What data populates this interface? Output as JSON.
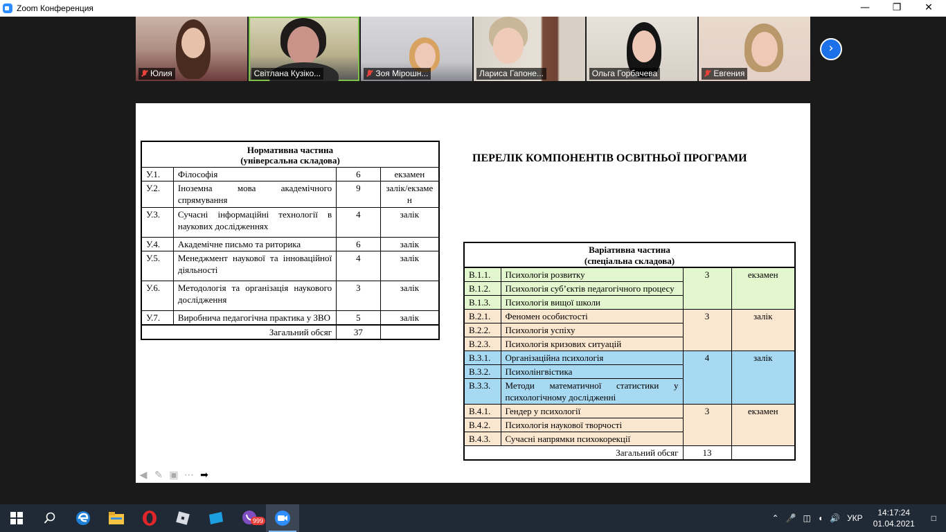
{
  "window": {
    "title": "Zoom Конференция",
    "minimize": "—",
    "maximize": "❐",
    "close": "✕"
  },
  "participants": [
    {
      "name": "Юлия",
      "muted": true
    },
    {
      "name": "Світлана Кузіко...",
      "muted": false,
      "active": true
    },
    {
      "name": "Зоя Мірошн...",
      "muted": true
    },
    {
      "name": "Лариса Гапоне...",
      "muted": false
    },
    {
      "name": "Ольга Горбачева",
      "muted": false
    },
    {
      "name": "Евгения",
      "muted": true
    }
  ],
  "slide": {
    "heading": "ПЕРЕЛІК КОМПОНЕНТІВ ОСВІТНЬОЇ ПРОГРАМИ",
    "normative": {
      "title1": "Нормативна частина",
      "title2": "(універсальна складова)",
      "rows": [
        {
          "code": "У.1.",
          "name": "Філософія",
          "credits": "6",
          "form": "екзамен"
        },
        {
          "code": "У.2.",
          "name": "Іноземна мова академічного спрямування",
          "credits": "9",
          "form": "залік/екзаме н"
        },
        {
          "code": "У.3.",
          "name": "Сучасні інформаційні технології в наукових дослідженнях",
          "credits": "4",
          "form": "залік"
        },
        {
          "code": "У.4.",
          "name": "Академічне письмо та риторика",
          "credits": "6",
          "form": "залік"
        },
        {
          "code": "У.5.",
          "name": "Менеджмент наукової та інноваційної діяльності",
          "credits": "4",
          "form": "залік"
        },
        {
          "code": "У.6.",
          "name": "Методологія та організація наукового дослідження",
          "credits": "3",
          "form": "залік"
        },
        {
          "code": "У.7.",
          "name": "Виробнича педагогічна практика у ЗВО",
          "credits": "5",
          "form": "залік"
        }
      ],
      "total_label": "Загальний обсяг",
      "total_value": "37"
    },
    "variative": {
      "title1": "Варіативна частина",
      "title2": "(спеціальна складова)",
      "groups": [
        {
          "credits": "3",
          "form": "екзамен",
          "color": "#e2f7cd",
          "rows": [
            {
              "code": "В.1.1.",
              "name": "Психологія розвитку"
            },
            {
              "code": "В.1.2.",
              "name": "Психологія суб’єктів педагогічного процесу"
            },
            {
              "code": "В.1.3.",
              "name": "Психологія вищої школи"
            }
          ]
        },
        {
          "credits": "3",
          "form": "залік",
          "color": "#fbe6cf",
          "rows": [
            {
              "code": "В.2.1.",
              "name": "Феномен особистості"
            },
            {
              "code": "В.2.2.",
              "name": "Психологія успіху"
            },
            {
              "code": "В.2.3.",
              "name": "Психологія кризових ситуацій"
            }
          ]
        },
        {
          "credits": "4",
          "form": "залік",
          "color": "#a8d9f2",
          "rows": [
            {
              "code": "В.3.1.",
              "name": "Організаційна психологія"
            },
            {
              "code": "В.3.2.",
              "name": "Психолінгвістика"
            },
            {
              "code": "В.3.3.",
              "name": "Методи математичної статистики у психологічному дослідженні"
            }
          ]
        },
        {
          "credits": "3",
          "form": "екзамен",
          "color": "#fbe6cf",
          "rows": [
            {
              "code": "В.4.1.",
              "name": "Гендер у психології"
            },
            {
              "code": "В.4.2.",
              "name": "Психологія наукової творчості"
            },
            {
              "code": "В.4.3.",
              "name": "Сучасні напрямки психокорекції"
            }
          ]
        }
      ],
      "total_label": "Загальний обсяг",
      "total_value": "13"
    }
  },
  "taskbar": {
    "viber_badge": "999",
    "language": "УКР",
    "time": "14:17:24",
    "date": "01.04.2021"
  }
}
